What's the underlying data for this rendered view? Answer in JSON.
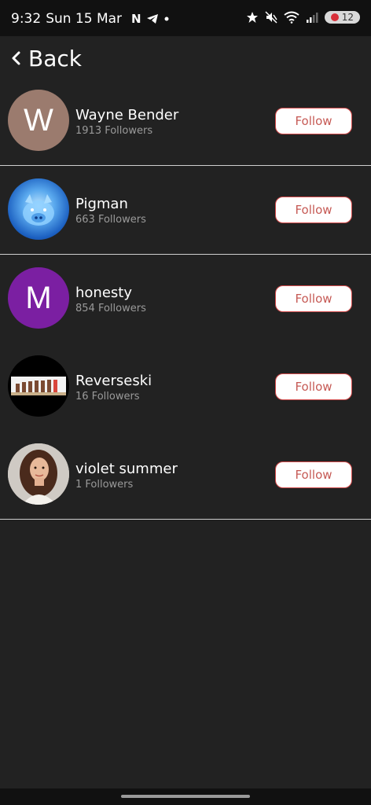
{
  "status_bar": {
    "time": "9:32",
    "date": "Sun 15 Mar",
    "battery_level": "12"
  },
  "header": {
    "back_label": "Back"
  },
  "users": [
    {
      "name": "Wayne Bender",
      "followers": "1913 Followers",
      "avatar_letter": "W",
      "avatar_color": "#9b7b6e",
      "button": "Follow"
    },
    {
      "name": "Pigman",
      "followers": "663 Followers",
      "avatar_letter": "",
      "avatar_color": "#2d7dd6",
      "button": "Follow"
    },
    {
      "name": "honesty",
      "followers": "854 Followers",
      "avatar_letter": "M",
      "avatar_color": "#7b1fa2",
      "button": "Follow"
    },
    {
      "name": "Reverseski",
      "followers": "16 Followers",
      "avatar_letter": "",
      "avatar_color": "#000000",
      "button": "Follow"
    },
    {
      "name": "violet summer",
      "followers": "1 Followers",
      "avatar_letter": "",
      "avatar_color": "#6b4a3c",
      "button": "Follow"
    }
  ],
  "colors": {
    "background": "#222222",
    "follow_text": "#c65a55",
    "follow_border": "#d24a4a"
  }
}
